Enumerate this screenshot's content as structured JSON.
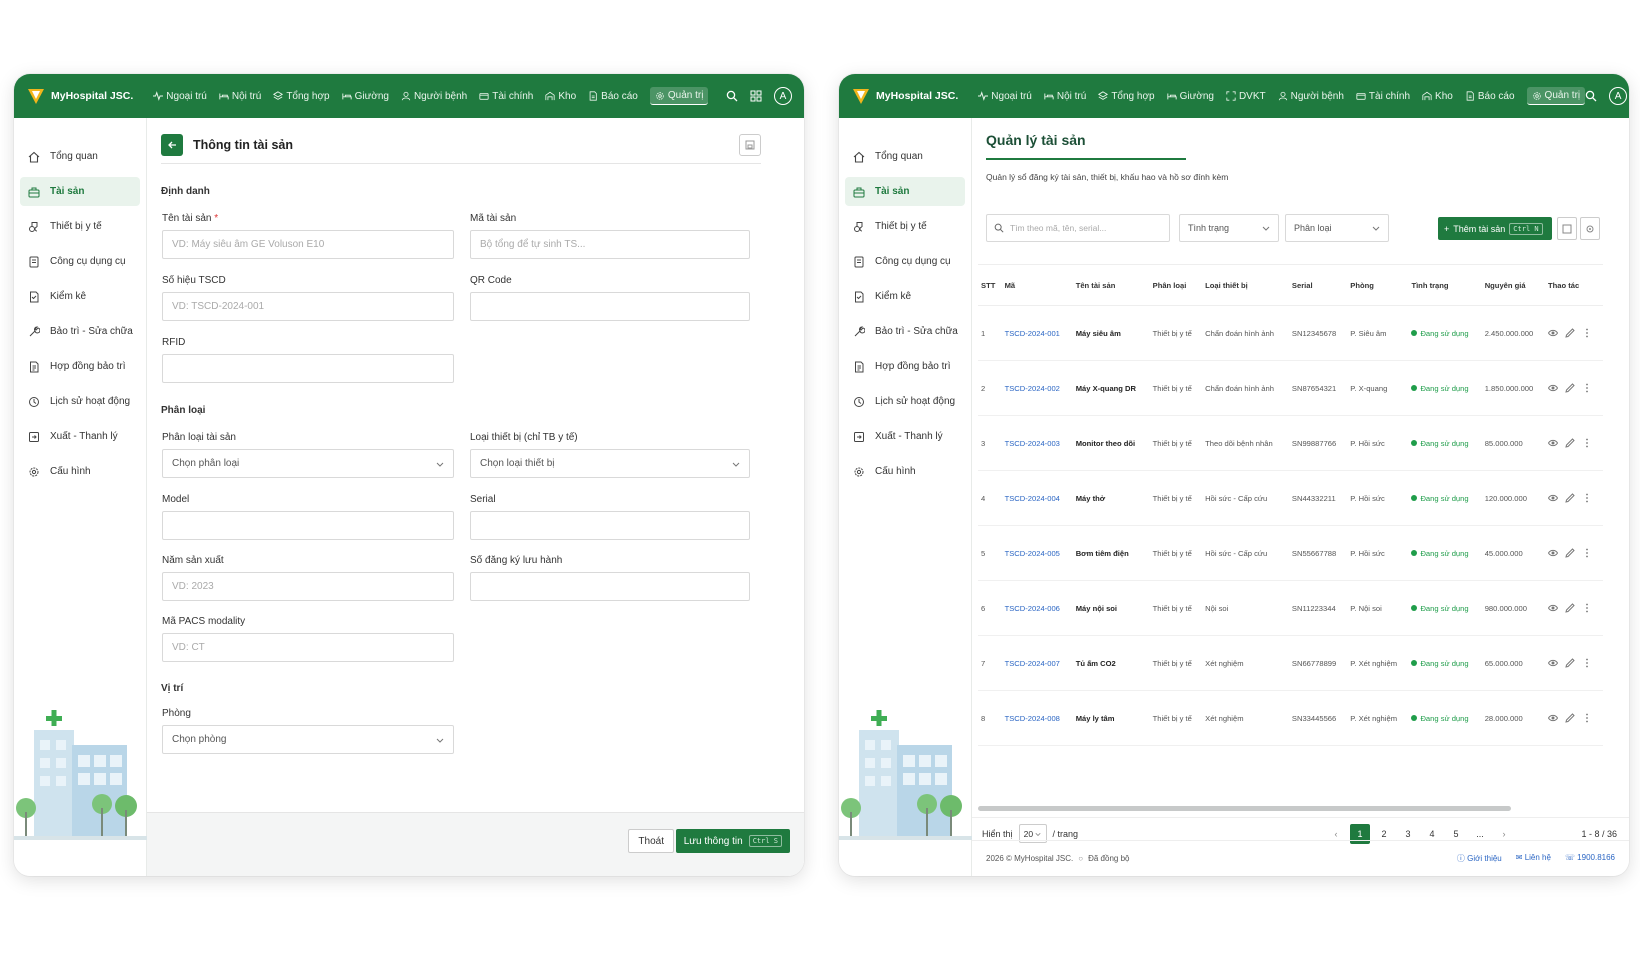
{
  "brand": {
    "name": "MyHospital JSC.",
    "accent": "#1f7a3f"
  },
  "left": {
    "nav": [
      "Ngoại trú",
      "Nội trú",
      "Tổng hợp",
      "Giường",
      "Người bệnh",
      "Tài chính",
      "Kho",
      "Báo cáo",
      "Quản trị"
    ],
    "nav_icons": [
      "pulse-icon",
      "bed-icon",
      "layers-icon",
      "bed-icon",
      "user-icon",
      "wallet-icon",
      "warehouse-icon",
      "report-icon",
      "gear-icon"
    ],
    "avatar": "A",
    "form": {
      "title": "Thông tin tài sản",
      "sec_identity": "Định danh",
      "asset_name_label": "Tên tài sản",
      "required_mark": "*",
      "asset_name_ph": "VD: Máy siêu âm GE Voluson E10",
      "asset_code_label": "Mã tài sản",
      "asset_code_ph": "Bộ tổng để tự sinh TS...",
      "tscd_label": "Số hiệu TSCD",
      "tscd_ph": "VD: TSCD-2024-001",
      "qr_label": "QR Code",
      "rfid_label": "RFID",
      "sec_class": "Phân loại",
      "class_label": "Phân loại tài sản",
      "class_ph": "Chọn phân loại",
      "device_type_label": "Loại thiết bị (chỉ TB y tế)",
      "device_type_ph": "Chọn loại thiết bị",
      "model_label": "Model",
      "serial_label": "Serial",
      "year_label": "Năm sản xuất",
      "year_ph": "VD: 2023",
      "reg_label": "Số đăng ký lưu hành",
      "pacs_label": "Mã PACS modality",
      "pacs_ph": "VD: CT",
      "sec_location": "Vị trí",
      "room_label": "Phòng",
      "room_ph": "Chọn phòng",
      "exit_btn": "Thoát",
      "save_btn": "Lưu thông tin",
      "save_kbd": "Ctrl S"
    }
  },
  "sidebar": [
    {
      "label": "Tổng quan",
      "icon": "home-icon"
    },
    {
      "label": "Tài sản",
      "icon": "asset-icon"
    },
    {
      "label": "Thiết bị y tế",
      "icon": "medical-device-icon"
    },
    {
      "label": "Công cụ dụng cụ",
      "icon": "tools-icon"
    },
    {
      "label": "Kiểm kê",
      "icon": "checklist-icon"
    },
    {
      "label": "Bảo trì - Sửa chữa",
      "icon": "wrench-icon"
    },
    {
      "label": "Hợp đồng bảo trì",
      "icon": "contract-icon"
    },
    {
      "label": "Lịch sử hoạt động",
      "icon": "history-icon"
    },
    {
      "label": "Xuất - Thanh lý",
      "icon": "export-icon"
    },
    {
      "label": "Cấu hình",
      "icon": "gear-icon"
    }
  ],
  "right": {
    "nav": [
      "Ngoại trú",
      "Nội trú",
      "Tổng hợp",
      "Giường",
      "DVKT",
      "Người bệnh",
      "Tài chính",
      "Kho",
      "Báo cáo",
      "Quản trị"
    ],
    "nav_icons": [
      "pulse-icon",
      "bed-icon",
      "layers-icon",
      "bed-icon",
      "scan-icon",
      "user-icon",
      "wallet-icon",
      "warehouse-icon",
      "report-icon",
      "gear-icon"
    ],
    "avatar": "A",
    "title": "Quản lý tài sản",
    "desc": "Quản lý sổ đăng ký tài sản, thiết bị, khấu hao và hồ sơ đính kèm",
    "search_ph": "Tìm theo mã, tên, serial...",
    "filter_status": "Tình trạng",
    "filter_class": "Phân loại",
    "add_btn": "Thêm tài sản",
    "add_kbd": "Ctrl N",
    "columns": [
      "STT",
      "Mã",
      "Tên tài sản",
      "Phân loại",
      "Loại thiết bị",
      "Serial",
      "Phòng",
      "Tình trạng",
      "Nguyên giá",
      "Thao tác"
    ],
    "rows": [
      [
        "1",
        "TSCD-2024-001",
        "Máy siêu âm",
        "Thiết bị y tế",
        "Chẩn đoán hình ảnh",
        "SN12345678",
        "P. Siêu âm",
        "Đang sử dụng",
        "2.450.000.000"
      ],
      [
        "2",
        "TSCD-2024-002",
        "Máy X-quang DR",
        "Thiết bị y tế",
        "Chẩn đoán hình ảnh",
        "SN87654321",
        "P. X-quang",
        "Đang sử dụng",
        "1.850.000.000"
      ],
      [
        "3",
        "TSCD-2024-003",
        "Monitor theo dõi",
        "Thiết bị y tế",
        "Theo dõi bệnh nhân",
        "SN99887766",
        "P. Hồi sức",
        "Đang sử dụng",
        "85.000.000"
      ],
      [
        "4",
        "TSCD-2024-004",
        "Máy thở",
        "Thiết bị y tế",
        "Hồi sức - Cấp cứu",
        "SN44332211",
        "P. Hồi sức",
        "Đang sử dụng",
        "120.000.000"
      ],
      [
        "5",
        "TSCD-2024-005",
        "Bơm tiêm điện",
        "Thiết bị y tế",
        "Hồi sức - Cấp cứu",
        "SN55667788",
        "P. Hồi sức",
        "Đang sử dụng",
        "45.000.000"
      ],
      [
        "6",
        "TSCD-2024-006",
        "Máy nội soi",
        "Thiết bị y tế",
        "Nội soi",
        "SN11223344",
        "P. Nội soi",
        "Đang sử dụng",
        "980.000.000"
      ],
      [
        "7",
        "TSCD-2024-007",
        "Tủ ấm CO2",
        "Thiết bị y tế",
        "Xét nghiệm",
        "SN66778899",
        "P. Xét nghiệm",
        "Đang sử dụng",
        "65.000.000"
      ],
      [
        "8",
        "TSCD-2024-008",
        "Máy ly tâm",
        "Thiết bị y tế",
        "Xét nghiệm",
        "SN33445566",
        "P. Xét nghiệm",
        "Đang sử dụng",
        "28.000.000"
      ]
    ],
    "pager": {
      "show_label": "Hiển thị",
      "per_page": "20",
      "per_unit": "/ trang",
      "pages": [
        "1",
        "2",
        "3",
        "4",
        "5",
        "..."
      ],
      "range": "1 - 8 / 36"
    },
    "footer": {
      "copyright": "2026 © MyHospital JSC.",
      "sync": "Đã đồng bộ",
      "about": "Giới thiệu",
      "contact": "Liên hệ",
      "phone": "1900.8166"
    }
  }
}
